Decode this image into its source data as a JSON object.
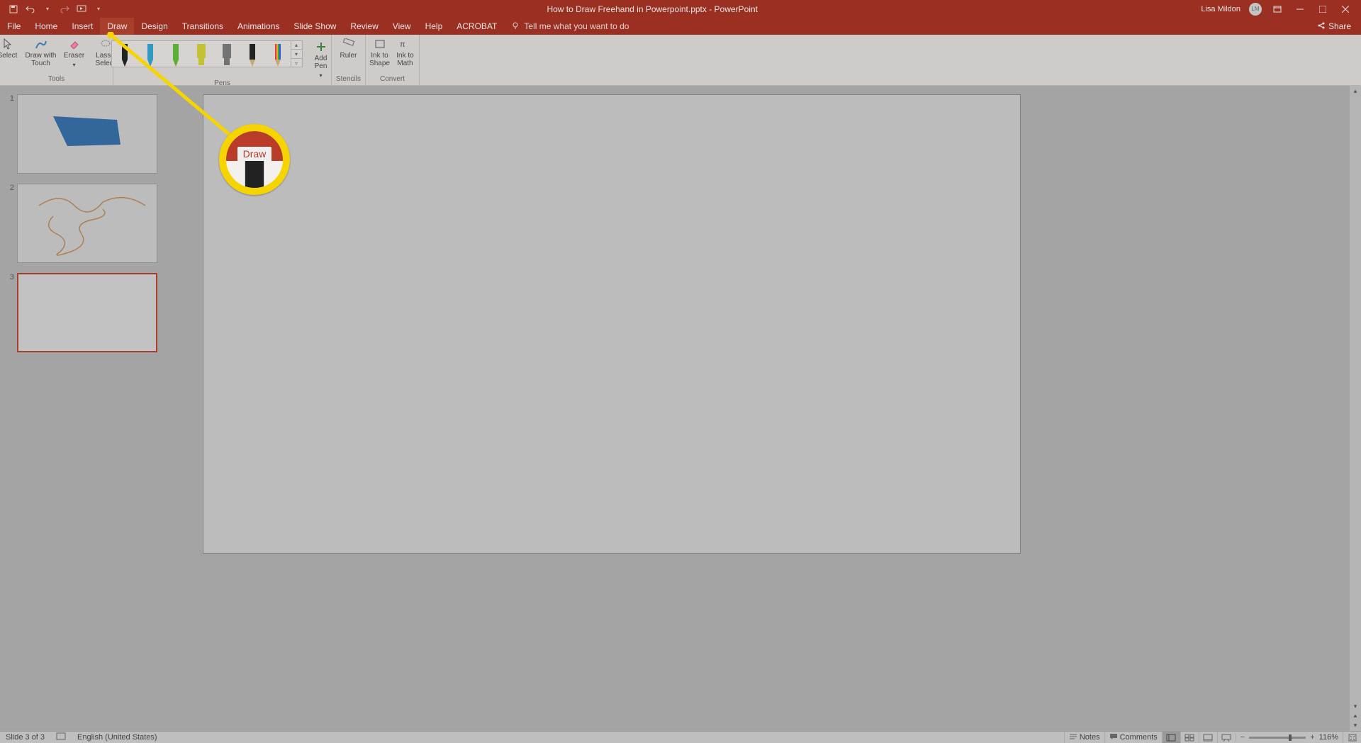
{
  "app": {
    "title": "How to Draw Freehand in Powerpoint.pptx - PowerPoint",
    "user": "Lisa Mildon",
    "initials": "LM"
  },
  "qat": {
    "save": "save-icon",
    "undo": "undo-icon",
    "redo": "redo-icon",
    "start": "start-from-beginning-icon",
    "more": "▾"
  },
  "tabs": {
    "items": [
      "File",
      "Home",
      "Insert",
      "Draw",
      "Design",
      "Transitions",
      "Animations",
      "Slide Show",
      "Review",
      "View",
      "Help",
      "ACROBAT"
    ],
    "active": "Draw",
    "tellme_placeholder": "Tell me what you want to do",
    "share": "Share"
  },
  "ribbon": {
    "tools": {
      "select": "Select",
      "draw_touch": "Draw with\nTouch",
      "eraser": "Eraser",
      "lasso": "Lasso\nSelect",
      "group_label": "Tools"
    },
    "pens": {
      "colors": [
        "#1a1a1a",
        "#2aa8d8",
        "#5fbf33",
        "#d6d62e",
        "#7a7a7a",
        "#1a1a1a",
        "#ff3bd4"
      ],
      "types": [
        "pen",
        "pen",
        "pen",
        "highlighter",
        "highlighter",
        "pencil",
        "pencil"
      ],
      "add_pen": "Add\nPen",
      "group_label": "Pens"
    },
    "stencils": {
      "ruler": "Ruler",
      "group_label": "Stencils"
    },
    "convert": {
      "shape": "Ink to\nShape",
      "math": "Ink to\nMath",
      "group_label": "Convert"
    }
  },
  "slides": {
    "items": [
      {
        "num": "1",
        "kind": "shape"
      },
      {
        "num": "2",
        "kind": "scribble"
      },
      {
        "num": "3",
        "kind": "blank"
      }
    ],
    "selected_index": 2
  },
  "callout": {
    "label": "Draw"
  },
  "status": {
    "slide_info": "Slide 3 of 3",
    "language": "English (United States)",
    "notes": "Notes",
    "comments": "Comments",
    "zoom": "116%"
  }
}
